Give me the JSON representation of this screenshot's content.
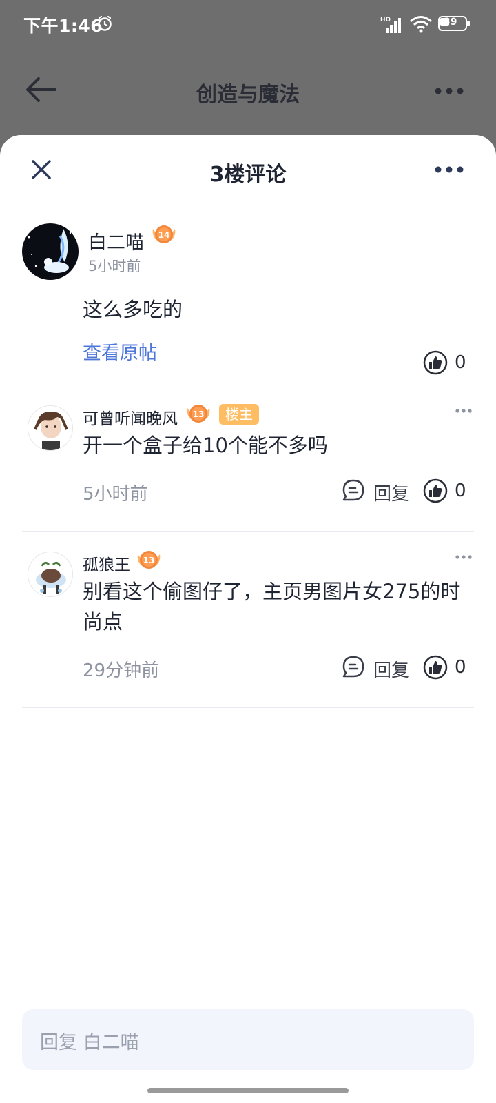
{
  "status_bar": {
    "time": "下午1:46",
    "network": "HD",
    "battery": "39"
  },
  "background_page": {
    "title": "创造与魔法"
  },
  "sheet": {
    "title": "3楼评论"
  },
  "main_comment": {
    "author": "白二喵",
    "level": "14",
    "time": "5小时前",
    "text": "这么多吃的",
    "view_original": "查看原帖",
    "likes": "0"
  },
  "replies": [
    {
      "author": "可曾听闻晚风",
      "level": "13",
      "badge": "楼主",
      "text": "开一个盒子给10个能不多吗",
      "time": "5小时前",
      "reply_label": "回复",
      "likes": "0"
    },
    {
      "author": "孤狼王",
      "level": "13",
      "text": "别看这个偷图仔了，主页男图片女275的时尚点",
      "time": "29分钟前",
      "reply_label": "回复",
      "likes": "0"
    }
  ],
  "input": {
    "placeholder": "回复 白二喵"
  },
  "colors": {
    "accent_link": "#4c77d9",
    "level_badge": "#f2873c",
    "op_badge": "#ffbd63",
    "input_bg": "#f2f5fc"
  },
  "icons": [
    "alarm-icon",
    "signal-icon",
    "wifi-icon",
    "battery-icon",
    "back-arrow-icon",
    "more-icon",
    "close-icon",
    "level-badge-icon",
    "like-icon",
    "reply-bubble-icon"
  ]
}
